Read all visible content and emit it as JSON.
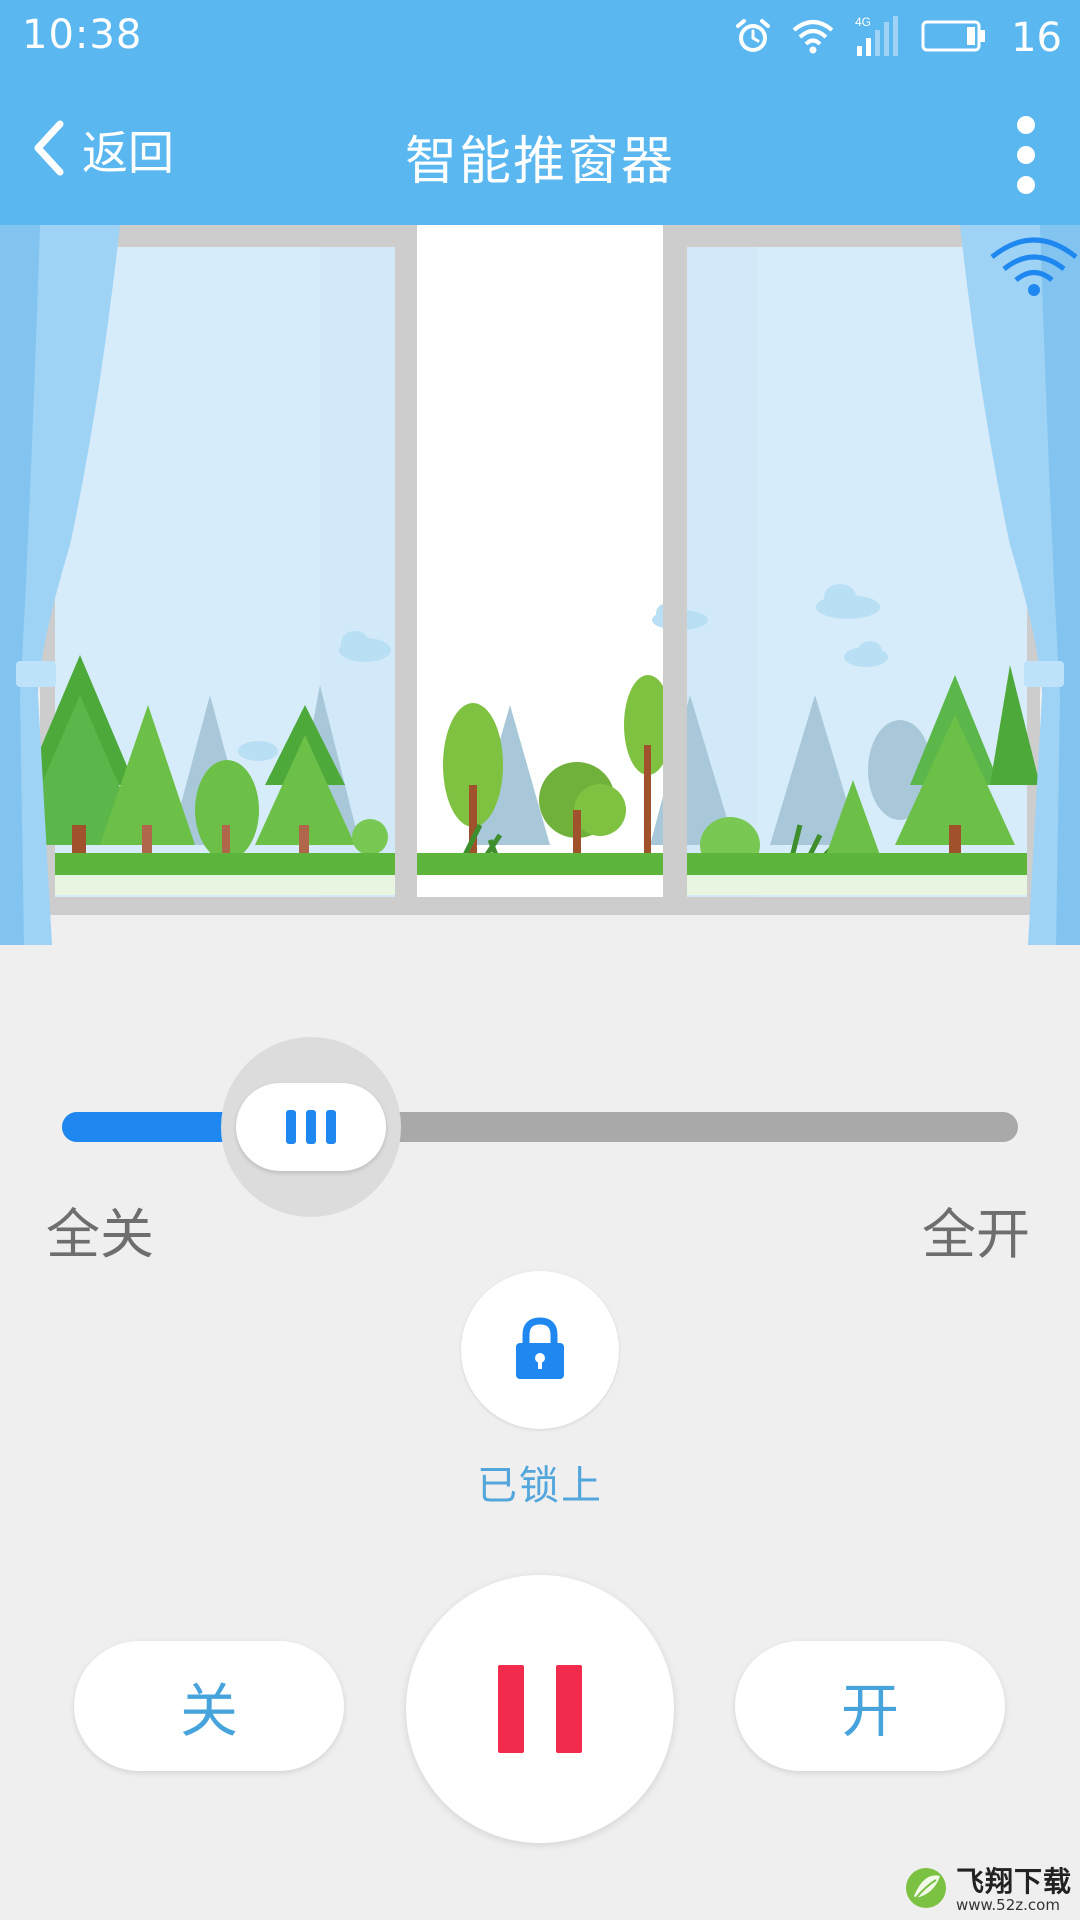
{
  "status_bar": {
    "time": "10:38",
    "battery_level": "16",
    "network": "4G"
  },
  "header": {
    "back_label": "返回",
    "title": "智能推窗器"
  },
  "colors": {
    "primary_blue": "#5ab7ef",
    "accent_blue": "#1e88f0",
    "pause_red": "#f22a4c",
    "label_blue": "#47a3dc"
  },
  "icons": {
    "alarm": "alarm-clock-icon",
    "wifi": "wifi-icon",
    "signal": "cell-signal-icon",
    "battery": "battery-icon",
    "back": "chevron-left-icon",
    "more": "more-vertical-icon",
    "lock": "lock-icon",
    "pause": "pause-icon"
  },
  "slider": {
    "left_label": "全关",
    "right_label": "全开",
    "position_percent": 26
  },
  "lock": {
    "status": "已锁上"
  },
  "controls": {
    "close_label": "关",
    "open_label": "开"
  },
  "watermark": {
    "name": "飞翔下载",
    "url": "www.52z.com"
  }
}
